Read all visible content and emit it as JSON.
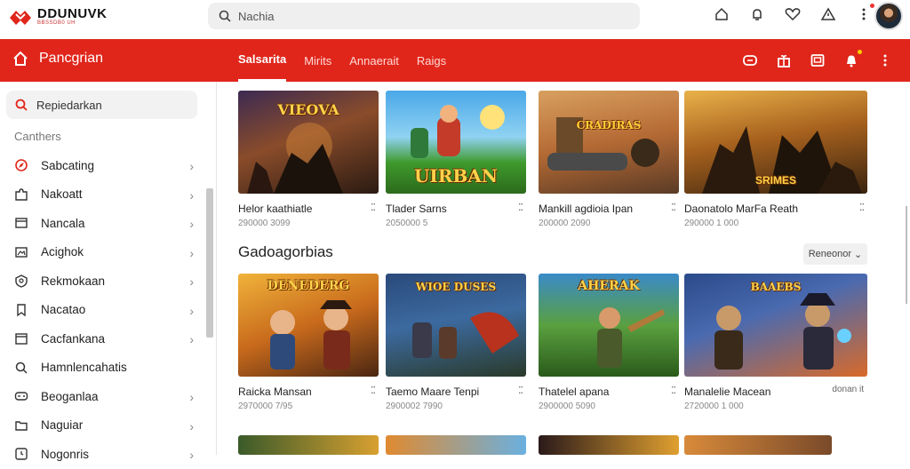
{
  "brand": {
    "name": "DDUNUVK",
    "tagline": "BBSSDB0 UH"
  },
  "search": {
    "placeholder": "Nachia"
  },
  "colors": {
    "accent": "#e0261b"
  },
  "top_icons": [
    "home-outline-icon",
    "bell-outline-icon",
    "heart-icon",
    "warning-icon",
    "more-vertical-icon"
  ],
  "redbar": {
    "home_label": "Pancgrian",
    "tabs": [
      {
        "label": "Salsarita",
        "active": true
      },
      {
        "label": "Mirits",
        "active": false
      },
      {
        "label": "Annaerait",
        "active": false
      },
      {
        "label": "Raigs",
        "active": false
      }
    ]
  },
  "sidebar": {
    "search_label": "Repiedarkan",
    "heading": "Canthers",
    "items": [
      {
        "label": "Sabcating",
        "icon": "compass-icon",
        "chevron": true
      },
      {
        "label": "Nakoatt",
        "icon": "puzzle-icon",
        "chevron": true
      },
      {
        "label": "Nancala",
        "icon": "window-icon",
        "chevron": true
      },
      {
        "label": "Acighok",
        "icon": "image-icon",
        "chevron": true
      },
      {
        "label": "Rekmokaan",
        "icon": "shield-icon",
        "chevron": true
      },
      {
        "label": "Nacatao",
        "icon": "bookmark-icon",
        "chevron": true
      },
      {
        "label": "Cacfankana",
        "icon": "calendar-icon",
        "chevron": true
      },
      {
        "label": "Hamnlencahatis",
        "icon": "search-icon",
        "chevron": false
      },
      {
        "label": "Beoganlaa",
        "icon": "game-icon",
        "chevron": true
      },
      {
        "label": "Naguiar",
        "icon": "folder-icon",
        "chevron": true
      },
      {
        "label": "Nogonris",
        "icon": "clock-icon",
        "chevron": true
      }
    ]
  },
  "row1": [
    {
      "thumb_text": "VIEOVA",
      "title": "Helor kaathiatle",
      "meta": "290000 3099"
    },
    {
      "thumb_text": "UIRBAN",
      "title": "Tlader Sarns",
      "meta": "2050000 5"
    },
    {
      "thumb_text": "CRADIRAS",
      "title": "Mankill agdioia Ipan",
      "meta": "200000 2090"
    },
    {
      "thumb_text": "SRIMES",
      "title": "Daonatolo MarFa Reath",
      "meta": "290000 1 000"
    }
  ],
  "section": {
    "title": "Gadoagorbias",
    "sort_label": "Reneonor"
  },
  "row2": [
    {
      "thumb_text": "DENEDERG",
      "title": "Raicka Mansan",
      "meta": "2970000 7/95"
    },
    {
      "thumb_text": "WIOE DUSES",
      "title": "Taemo Maare Tenpi",
      "meta": "2900002 7990"
    },
    {
      "thumb_text": "AHERAK",
      "title": "Thatelel apana",
      "meta": "2900000 5090"
    },
    {
      "thumb_text": "BAAEBS",
      "title": "Manalelie Macean",
      "meta": "2720000 1 000",
      "extra": "donan it"
    }
  ]
}
